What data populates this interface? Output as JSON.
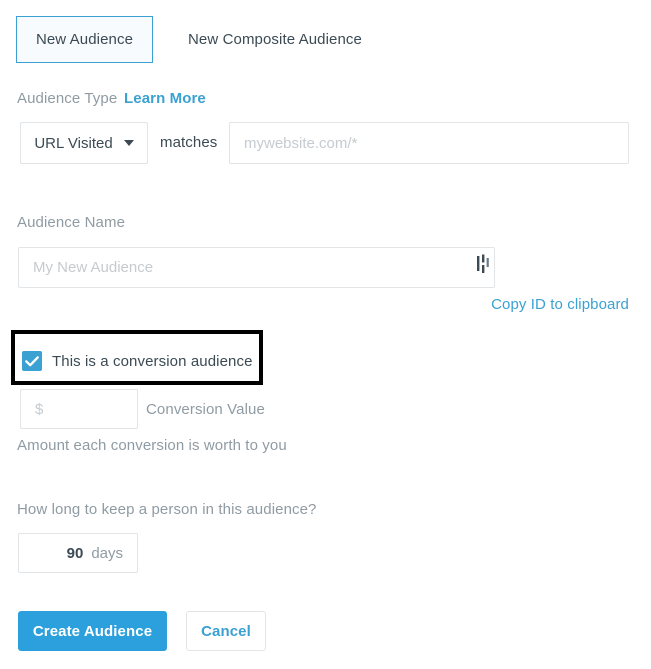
{
  "tabs": [
    {
      "label": "New Audience",
      "active": true
    },
    {
      "label": "New Composite Audience",
      "active": false
    }
  ],
  "audience_type": {
    "label": "Audience Type",
    "learn_more_label": "Learn More",
    "selected_option": "URL Visited",
    "options": [
      "URL Visited"
    ],
    "operator_label": "matches",
    "url_value": "",
    "url_placeholder": "mywebsite.com/*"
  },
  "audience_name": {
    "label": "Audience Name",
    "value": "",
    "placeholder": "My New Audience",
    "copy_id_label": "Copy ID to clipboard"
  },
  "conversion": {
    "checkbox_label": "This is a conversion audience",
    "checked": true,
    "value": "",
    "value_placeholder": "$",
    "value_label": "Conversion Value",
    "help_text": "Amount each conversion is worth to you"
  },
  "duration": {
    "question": "How long to keep a person in this audience?",
    "value": "90",
    "unit": "days"
  },
  "actions": {
    "primary_label": "Create Audience",
    "secondary_label": "Cancel"
  },
  "colors": {
    "accent": "#3ba1d3",
    "primary_button": "#2ba0dd",
    "text": "#3b4a54",
    "muted_text": "#8f9ba3",
    "border": "#e2e5e7",
    "placeholder": "#c5cbcf",
    "annotation": "#000000",
    "active_tab_bg": "#f7fbfd"
  },
  "icons": {
    "caret": "chevron-down-icon",
    "checkmark": "check-icon",
    "text_cursor": "text-cursor-icon"
  }
}
